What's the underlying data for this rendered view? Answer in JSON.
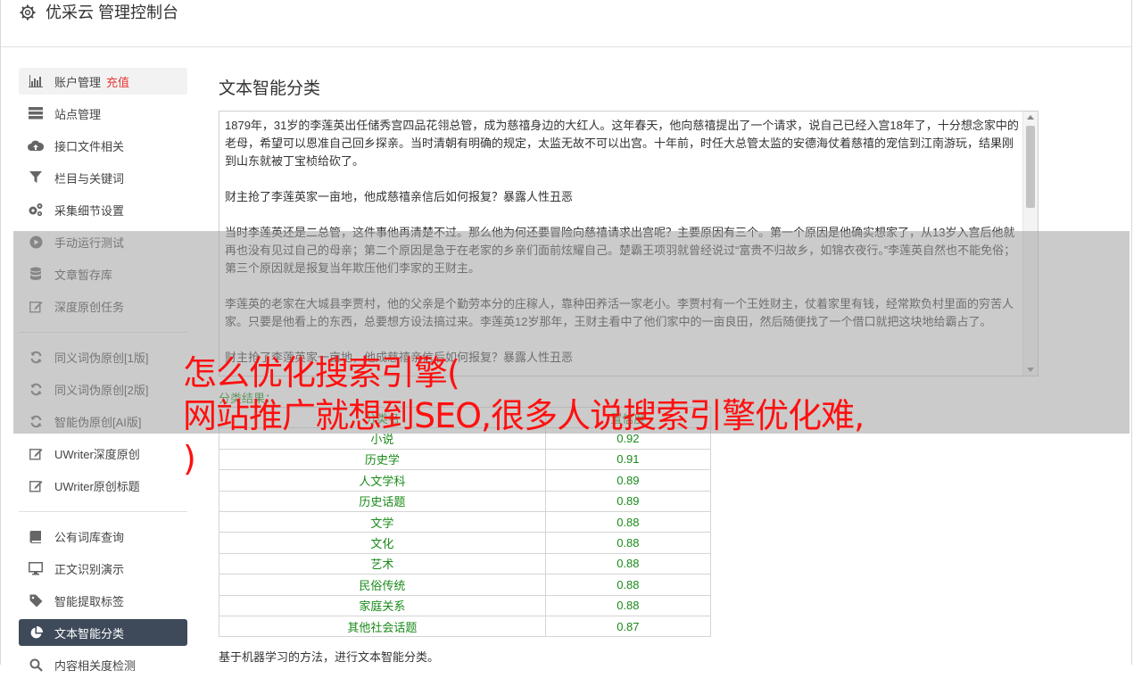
{
  "header": {
    "title": "优采云 管理控制台",
    "icon": "gear-icon"
  },
  "sidebar": {
    "items": [
      {
        "label": "账户管理",
        "badge": "充值",
        "icon": "bar-chart-icon"
      },
      {
        "label": "站点管理",
        "icon": "server-icon"
      },
      {
        "label": "接口文件相关",
        "icon": "cloud-upload-icon"
      },
      {
        "label": "栏目与关键词",
        "icon": "filter-icon"
      },
      {
        "label": "采集细节设置",
        "icon": "gears-icon"
      },
      {
        "label": "手动运行测试",
        "icon": "play-circle-icon"
      },
      {
        "label": "文章暂存库",
        "icon": "database-icon"
      },
      {
        "label": "深度原创任务",
        "icon": "edit-icon"
      },
      {
        "label": "同义词伪原创[1版]",
        "icon": "refresh-icon"
      },
      {
        "label": "同义词伪原创[2版]",
        "icon": "refresh-icon"
      },
      {
        "label": "智能伪原创[AI版]",
        "icon": "refresh-icon"
      },
      {
        "label": "UWriter深度原创",
        "icon": "edit-icon"
      },
      {
        "label": "UWriter原创标题",
        "icon": "edit-icon"
      },
      {
        "label": "公有词库查询",
        "icon": "book-icon"
      },
      {
        "label": "正文识别演示",
        "icon": "monitor-icon"
      },
      {
        "label": "智能提取标签",
        "icon": "tag-icon"
      },
      {
        "label": "文本智能分类",
        "icon": "pie-chart-icon"
      },
      {
        "label": "内容相关度检测",
        "icon": "search-icon"
      }
    ]
  },
  "main": {
    "title": "文本智能分类",
    "paragraphs": [
      "1879年，31岁的李莲英出任储秀宫四品花翎总管，成为慈禧身边的大红人。这年春天，他向慈禧提出了一个请求，说自己已经入宫18年了，十分想念家中的老母，希望可以恩准自己回乡探亲。当时清朝有明确的规定，太监无故不可以出宫。十年前，时任大总管太监的安德海仗着慈禧的宠信到江南游玩，结果刚到山东就被丁宝桢给砍了。",
      "财主抢了李莲英家一亩地，他成慈禧亲信后如何报复？暴露人性丑恶",
      "当时李莲英还是二总管，这件事他再清楚不过。那么他为何还要冒险向慈禧请求出宫呢？主要原因有三个。第一个原因是他确实想家了，从13岁入宫后他就再也没有见过自己的母亲；第二个原因是急于在老家的乡亲们面前炫耀自己。楚霸王项羽就曾经说过“富贵不归故乡，如锦衣夜行。”李莲英自然也不能免俗；第三个原因就是报复当年欺压他们李家的王财主。",
      "李莲英的老家在大城县李贾村，他的父亲是个勤劳本分的庄稼人，靠种田养活一家老小。李贾村有一个王姓财主，仗着家里有钱，经常欺负村里面的穷苦人家。只要是他看上的东西，总要想方设法搞过来。李莲英12岁那年，王财主看中了他们家中的一亩良田，然后随便找了一个借口就把这块地给霸占了。",
      "财主抢了李莲英家一亩地，他成慈禧亲信后如何报复？暴露人性丑恶"
    ],
    "result_label": "分类结果：",
    "table": {
      "headers": [
        "分类名",
        "置信度"
      ],
      "rows": [
        [
          "小说",
          "0.92"
        ],
        [
          "历史学",
          "0.91"
        ],
        [
          "人文学科",
          "0.89"
        ],
        [
          "历史话题",
          "0.89"
        ],
        [
          "文学",
          "0.88"
        ],
        [
          "文化",
          "0.88"
        ],
        [
          "艺术",
          "0.88"
        ],
        [
          "民俗传统",
          "0.88"
        ],
        [
          "家庭关系",
          "0.88"
        ],
        [
          "其他社会话题",
          "0.87"
        ]
      ]
    },
    "footnote": "基于机器学习的方法，进行文本智能分类。"
  },
  "overlay": {
    "lines": [
      "怎么优化搜索引擎(",
      "网站推广就想到SEO,很多人说搜索引擎优化难,",
      ")"
    ]
  },
  "colors": {
    "active_bg": "#3e4a5a",
    "result_green": "#1a8a1a",
    "badge_red": "#e53935",
    "overlay_red": "#ff1010"
  }
}
